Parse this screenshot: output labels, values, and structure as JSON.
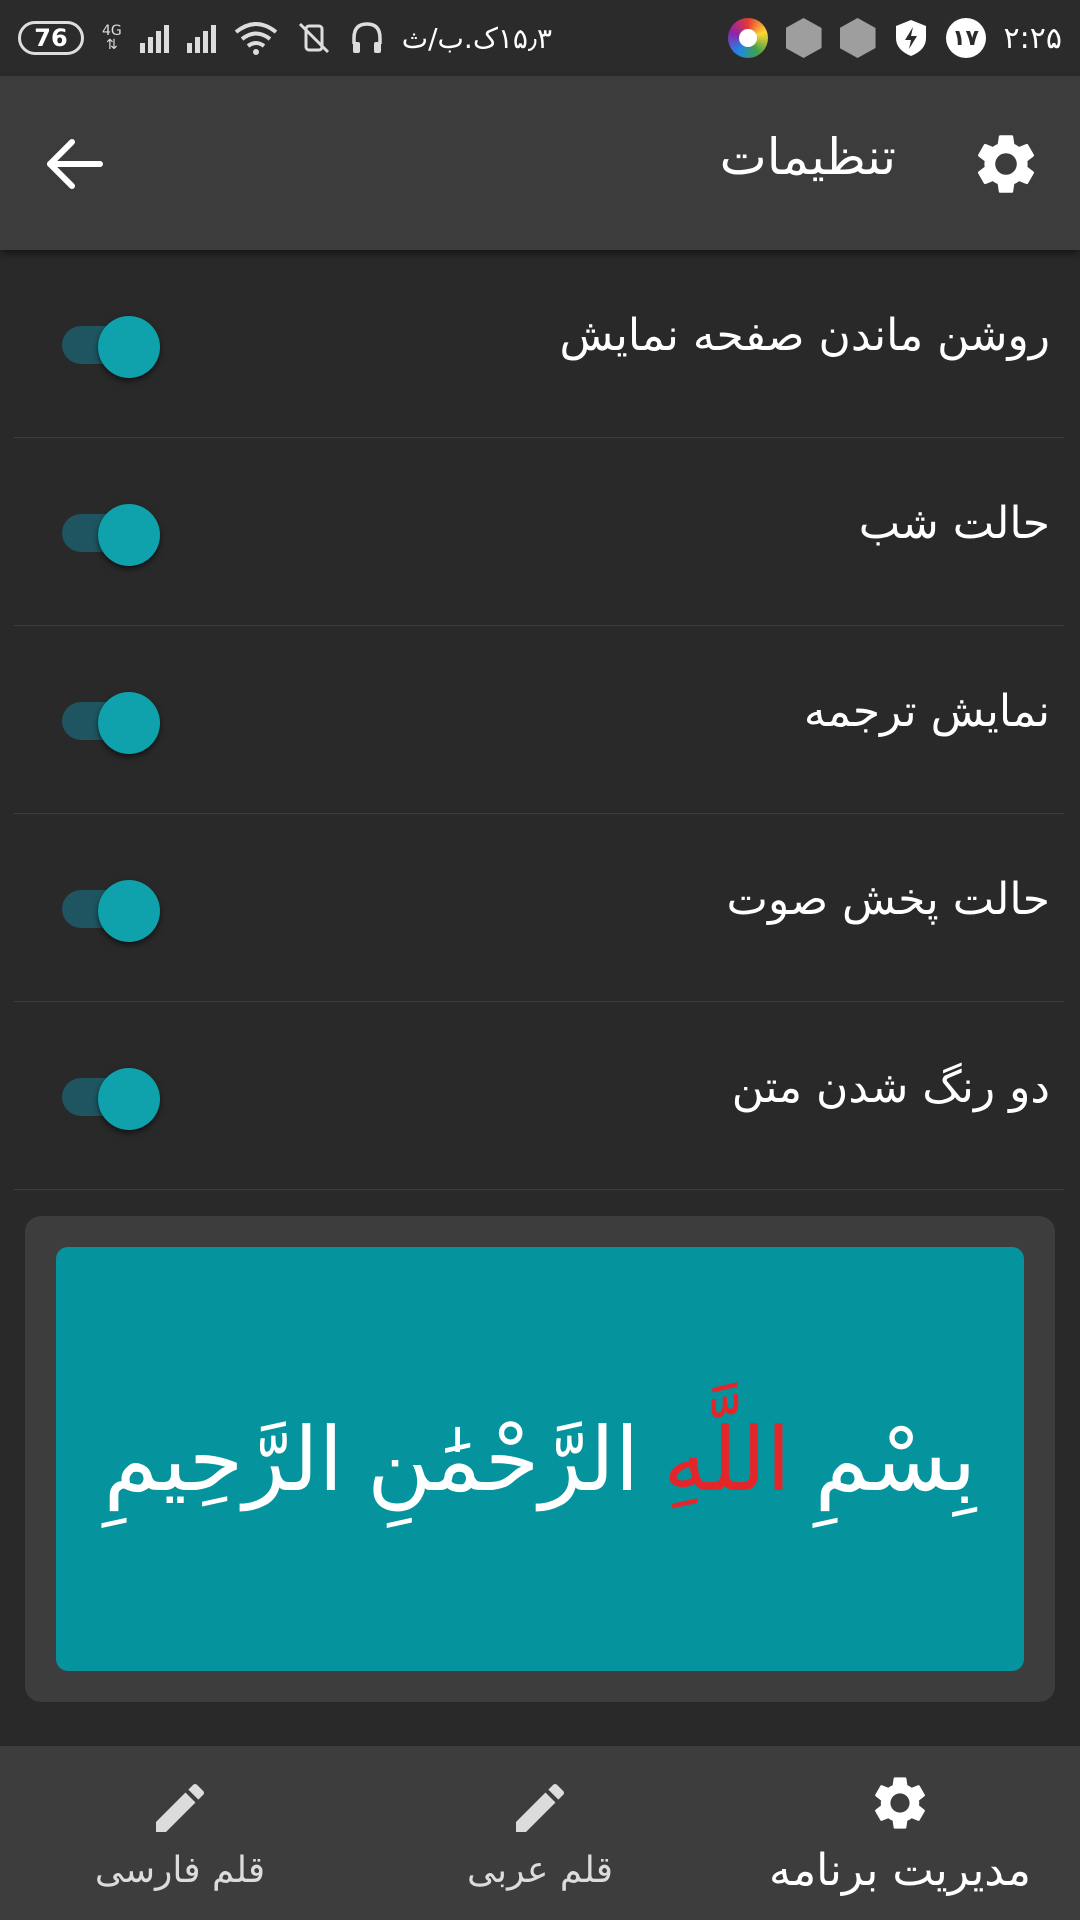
{
  "status_bar": {
    "time": "۲:۲۵",
    "notification_count": "۱۷",
    "battery": "76",
    "speed": "۱۵٫۳ک.ب/ث",
    "network": "4G"
  },
  "app_bar": {
    "title": "تنظیمات"
  },
  "settings": [
    {
      "label": "روشن ماندن صفحه نمایش",
      "enabled": true
    },
    {
      "label": "حالت شب",
      "enabled": true
    },
    {
      "label": "نمایش ترجمه",
      "enabled": true
    },
    {
      "label": "حالت پخش صوت",
      "enabled": true
    },
    {
      "label": "دو رنگ شدن متن",
      "enabled": true
    }
  ],
  "preview": {
    "word1": "بِسْمِ",
    "word2": "اللَّهِ",
    "word3": "الرَّحْمَٰنِ",
    "word4": "الرَّحِيمِ"
  },
  "bottom_nav": [
    {
      "label": "مدیریت برنامه",
      "icon": "gear-icon",
      "active": true
    },
    {
      "label": "قلم عربی",
      "icon": "pencil-icon",
      "active": false
    },
    {
      "label": "قلم فارسی",
      "icon": "pencil-icon",
      "active": false
    }
  ],
  "colors": {
    "background": "#292929",
    "app_bar": "#3c3c3c",
    "accent": "#0fa1ac",
    "switch_track": "#1e5560",
    "preview_bg": "#05939e",
    "highlight_text": "#e3262a"
  }
}
